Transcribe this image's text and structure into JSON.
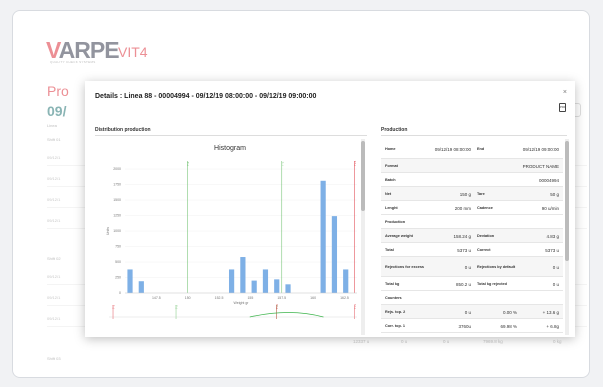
{
  "background": {
    "logo_main": "VARPE",
    "logo_sub": "QUALITY CHECK SYSTEMS",
    "app_name": "VIT4",
    "page_title": "Pro",
    "date": "09/",
    "line_label": "Linea",
    "shift_label_1": "Shift 01",
    "shift_label_2": "Shift 02",
    "shift_label_3": "Shift 03",
    "row_label": "09/12/1",
    "right_btn": "Filtre",
    "bottom_values": [
      "12337 u",
      "0 u",
      "0 u",
      "7969.8 kg",
      "0 kg"
    ]
  },
  "modal": {
    "title": "Details : Linea 88 - 00004994 - 09/12/19 08:00:00 - 09/12/19 09:00:00",
    "close": "×",
    "pdf": "PDF",
    "distribution_title": "Distribution production",
    "production_title": "Production"
  },
  "chart_data": {
    "type": "bar",
    "title": "Histogram",
    "xlabel": "Weight gr",
    "ylabel": "Units",
    "ylim": [
      0,
      2000
    ],
    "xlim": [
      145,
      163.5
    ],
    "yticks": [
      0,
      250,
      500,
      750,
      1000,
      1250,
      1500,
      1750,
      2000
    ],
    "xticks": [
      147.5,
      150,
      152.5,
      155,
      157.5,
      160,
      162.5
    ],
    "xtick_labels": [
      "147.5",
      "150",
      "152.5",
      "155",
      "157.5",
      "160",
      "162.5"
    ],
    "bins": [
      {
        "x": 145.4,
        "value": 380
      },
      {
        "x": 146.3,
        "value": 190
      },
      {
        "x": 153.5,
        "value": 380
      },
      {
        "x": 154.4,
        "value": 580
      },
      {
        "x": 155.3,
        "value": 200
      },
      {
        "x": 156.2,
        "value": 380
      },
      {
        "x": 157.1,
        "value": 220
      },
      {
        "x": 158.0,
        "value": 140
      },
      {
        "x": 160.8,
        "value": 1810
      },
      {
        "x": 161.7,
        "value": 1240
      },
      {
        "x": 162.6,
        "value": 380
      }
    ],
    "reference_lines": [
      {
        "x": 150,
        "color": "#7bc67b",
        "label": "T-2"
      },
      {
        "x": 157.5,
        "color": "#7bc67b",
        "label": "T-1"
      },
      {
        "x": 163.3,
        "color": "#e2545c",
        "label": "T+1"
      }
    ],
    "bar_color": "#7eb0e6"
  },
  "production": {
    "rows": [
      {
        "l1": "Home",
        "v1": "09/12/19 08:00:00",
        "l2": "End",
        "v2": "09/12/19 09:00:00",
        "tall": true
      },
      {
        "l1": "Format",
        "v1": "",
        "l2": "",
        "v2": "PRODUCT NAME",
        "shade": true
      },
      {
        "l1": "Batch",
        "v1": "",
        "l2": "",
        "v2": "00004994"
      },
      {
        "l1": "Net",
        "v1": "150 g",
        "l2": "Tare",
        "v2": "50 g",
        "shade": true
      },
      {
        "l1": "Lenght",
        "v1": "200 mm",
        "l2": "Cadence",
        "v2": "90 u/min"
      },
      {
        "l1": "Production",
        "v1": "",
        "l2": "",
        "v2": "",
        "section": true
      },
      {
        "l1": "Average weight",
        "v1": "158.24 g",
        "l2": "Deviation",
        "v2": "4.83 g",
        "shade": true
      },
      {
        "l1": "Total",
        "v1": "5373 u",
        "l2": "Correct",
        "v2": "5373 u"
      },
      {
        "l1": "Rejections for excess",
        "v1": "0 u",
        "l2": "Rejections by default",
        "v2": "0 u",
        "shade": true,
        "tall": true
      },
      {
        "l1": "Total kg",
        "v1": "850.2 u",
        "l2": "Total kg rejected",
        "v2": "0 u"
      },
      {
        "l1": "Counters",
        "v1": "",
        "l2": "",
        "v2": "",
        "section": true
      },
      {
        "l1": "Rejs. top. 2",
        "v1": "0 u",
        "l2": "0.00 %",
        "v2": "+ 13.6 g",
        "shade": true
      },
      {
        "l1": "Corr. top. 1",
        "v1": "3760u",
        "l2": "69.98 %",
        "v2": "+ 6.8g"
      }
    ]
  },
  "colors": {
    "brand_red": "#e2545c",
    "brand_teal": "#4a8c8c"
  }
}
